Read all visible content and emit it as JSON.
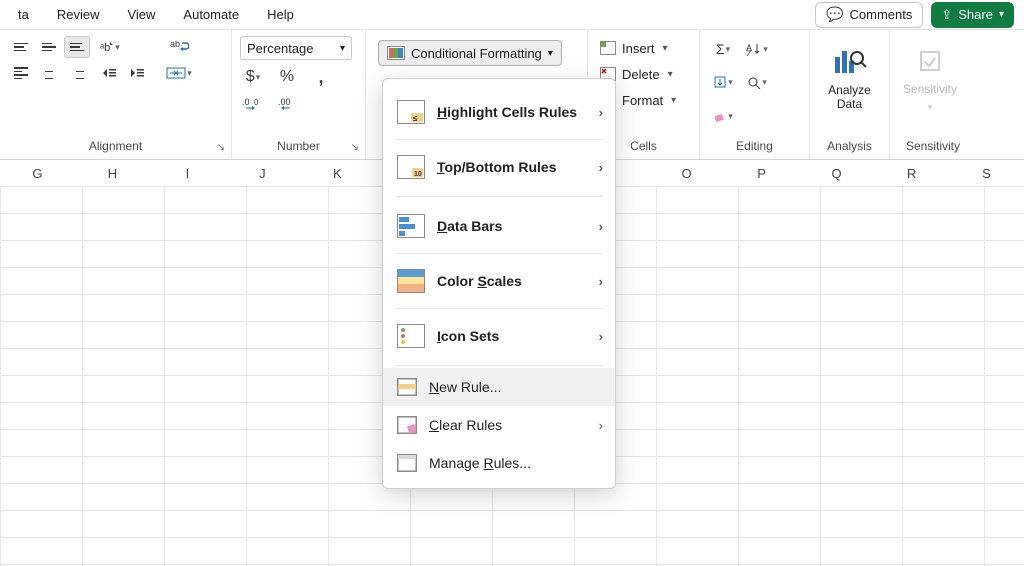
{
  "tabs": {
    "data": "ta",
    "review": "Review",
    "view": "View",
    "automate": "Automate",
    "help": "Help"
  },
  "top": {
    "comments": "Comments",
    "share": "Share"
  },
  "ribbon": {
    "alignment": {
      "label": "Alignment"
    },
    "number": {
      "label": "Number",
      "format": "Percentage",
      "currency": "$",
      "percent": "%",
      "comma": ",",
      "inc": ".0",
      "dec": ".00",
      "sub0": "0"
    },
    "cf": {
      "button": "Conditional Formatting"
    },
    "cells": {
      "label": "Cells",
      "insert": "Insert",
      "delete": "Delete",
      "format": "Format"
    },
    "editing": {
      "label": "Editing"
    },
    "analysis": {
      "label": "Analysis",
      "btn": "Analyze\nData"
    },
    "sensitivity": {
      "label": "Sensitivity",
      "btn": "Sensitivity"
    }
  },
  "menu": {
    "highlight": "Highlight Cells Rules",
    "topbottom": "Top/Bottom Rules",
    "databars": "Data Bars",
    "colorscales": "Color Scales",
    "iconsets": "Icon Sets",
    "newrule": "New Rule...",
    "clearrules": "Clear Rules",
    "managerules": "Manage Rules...",
    "hl_u": "H",
    "tb_u": "T",
    "db_u": "D",
    "cs_u": "S",
    "is_u": "I",
    "nr_u": "N",
    "cr_u": "C",
    "mr_u": "R"
  },
  "columns": [
    "G",
    "H",
    "I",
    "J",
    "K",
    "",
    "",
    "O",
    "P",
    "Q",
    "R",
    "S"
  ]
}
